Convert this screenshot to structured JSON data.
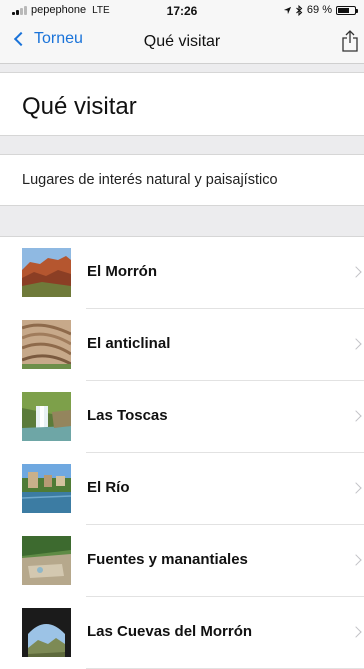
{
  "status_bar": {
    "carrier": "pepephone",
    "network": "LTE",
    "time": "17:26",
    "battery_percent": "69 %",
    "battery_level": 0.69,
    "icons": [
      "signal-bars-icon",
      "location-arrow-icon",
      "bluetooth-icon",
      "battery-icon"
    ]
  },
  "nav": {
    "back_label": "Torneu",
    "title": "Qué visitar",
    "share_icon": "share-icon",
    "accent_color": "#1a73d9"
  },
  "page": {
    "title": "Qué visitar",
    "section_label": "Lugares de interés natural y paisajístico"
  },
  "places": [
    {
      "name": "El Morrón",
      "thumbnail": "red-cliff-thumbnail"
    },
    {
      "name": "El anticlinal",
      "thumbnail": "rock-folds-thumbnail"
    },
    {
      "name": "Las Toscas",
      "thumbnail": "waterfall-thumbnail"
    },
    {
      "name": "El Río",
      "thumbnail": "river-town-thumbnail"
    },
    {
      "name": "Fuentes y manantiales",
      "thumbnail": "spring-thumbnail"
    },
    {
      "name": "Las Cuevas del Morrón",
      "thumbnail": "cave-thumbnail"
    }
  ]
}
